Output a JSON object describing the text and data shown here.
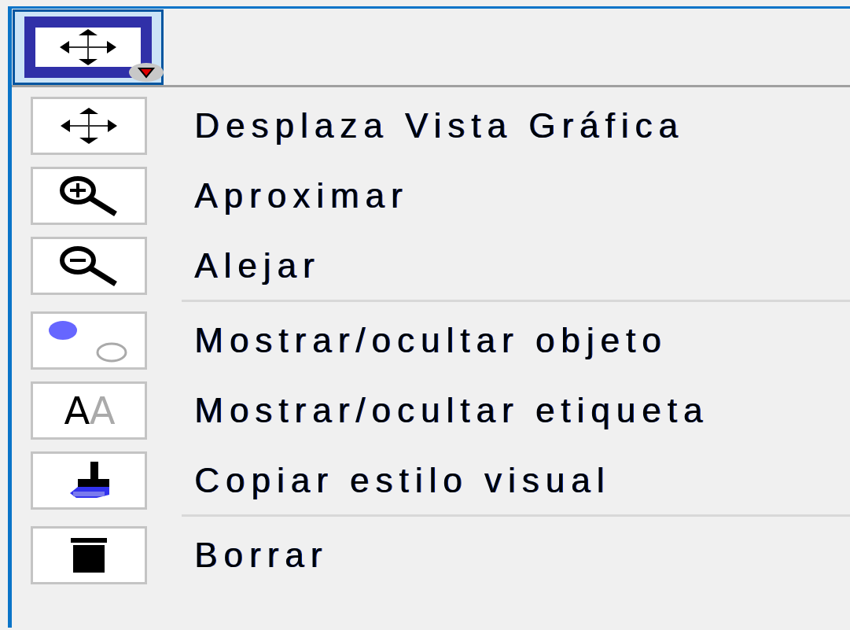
{
  "toolbar": {
    "tool": {
      "kind": "move",
      "selected": true
    }
  },
  "menu": {
    "groups": [
      [
        {
          "kind": "move",
          "label": "Desplaza Vista Gráfica"
        },
        {
          "kind": "zoom-in",
          "label": "Aproximar"
        },
        {
          "kind": "zoom-out",
          "label": "Alejar"
        }
      ],
      [
        {
          "kind": "show-hide-object",
          "label": "Mostrar/ocultar objeto"
        },
        {
          "kind": "show-hide-label",
          "label": "Mostrar/ocultar etiqueta",
          "glyphs": [
            "A",
            "A"
          ]
        },
        {
          "kind": "copy-style",
          "label": "Copiar estilo visual"
        }
      ],
      [
        {
          "kind": "delete",
          "label": "Borrar"
        }
      ]
    ]
  }
}
